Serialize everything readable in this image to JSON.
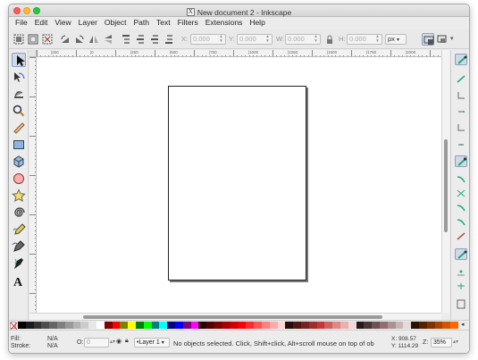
{
  "window": {
    "title": "New document 2 - Inkscape"
  },
  "menu": [
    "File",
    "Edit",
    "View",
    "Layer",
    "Object",
    "Path",
    "Text",
    "Filters",
    "Extensions",
    "Help"
  ],
  "toolbar": {
    "x_label": "X:",
    "x_value": "0.000",
    "y_label": "Y:",
    "y_value": "0.000",
    "w_label": "W:",
    "w_value": "0.000",
    "h_label": "H:",
    "h_value": "0.000",
    "unit": "px"
  },
  "ruler": {
    "h_ticks": [
      "|250",
      "|0",
      "|250",
      "|500",
      "|750",
      "|1000",
      "|1250",
      "|1500",
      "|1750",
      "|2000"
    ]
  },
  "palette": {
    "colors": [
      "#000000",
      "#1a1a1a",
      "#333333",
      "#4d4d4d",
      "#666666",
      "#808080",
      "#999999",
      "#b3b3b3",
      "#cccccc",
      "#e6e6e6",
      "#ffffff",
      "#800000",
      "#ff0000",
      "#808000",
      "#ffff00",
      "#008000",
      "#00ff00",
      "#008080",
      "#00ffff",
      "#000080",
      "#0000ff",
      "#800080",
      "#ff00ff",
      "#2b0000",
      "#550000",
      "#800000",
      "#aa0000",
      "#d40000",
      "#ff0000",
      "#ff2a2a",
      "#ff5555",
      "#ff8080",
      "#ffaaaa",
      "#ffd5d5",
      "#280b0b",
      "#501616",
      "#782121",
      "#a02c2c",
      "#c83737",
      "#d35f5f",
      "#de8787",
      "#e9afaf",
      "#f4d7d7",
      "#241c1c",
      "#483737",
      "#6c5353",
      "#916f6f",
      "#ac9393",
      "#c8b7b7",
      "#e3dbdb",
      "#2b1100",
      "#552200",
      "#803300",
      "#aa4400",
      "#d45500",
      "#ff6600"
    ]
  },
  "status": {
    "fill_label": "Fill:",
    "fill_value": "N/A",
    "stroke_label": "Stroke:",
    "stroke_value": "N/A",
    "opacity_label": "O:",
    "opacity_value": "0",
    "layer": "•Layer 1",
    "message": "No objects selected. Click, Shift+click, Alt+scroll mouse on top of ob",
    "x_coord": "X:   908.57",
    "y_coord": "Y: 1114.29",
    "zoom_label": "Z:",
    "zoom_value": "35%"
  }
}
